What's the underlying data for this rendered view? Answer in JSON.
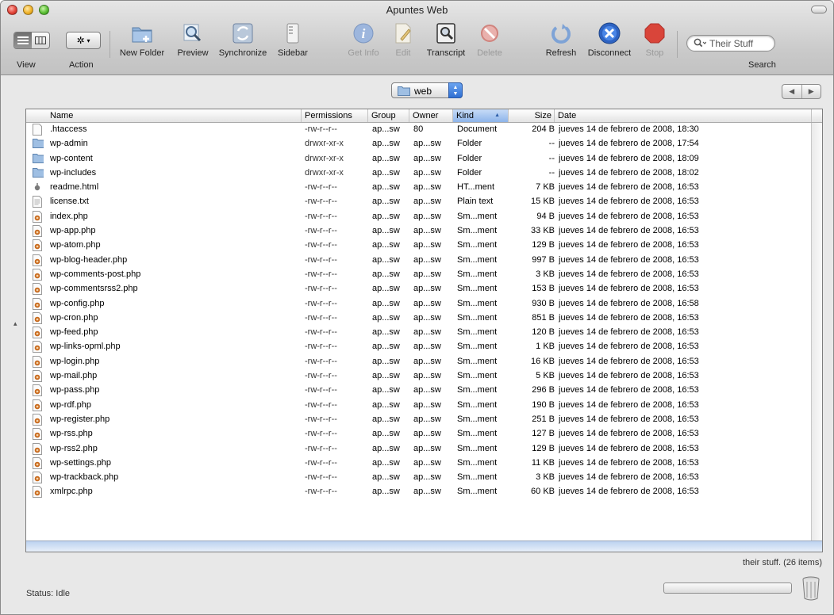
{
  "window": {
    "title": "Apuntes Web"
  },
  "toolbar": {
    "view_label": "View",
    "action_label": "Action",
    "new_folder": "New Folder",
    "preview": "Preview",
    "synchronize": "Synchronize",
    "sidebar": "Sidebar",
    "get_info": "Get Info",
    "edit": "Edit",
    "transcript": "Transcript",
    "delete": "Delete",
    "refresh": "Refresh",
    "disconnect": "Disconnect",
    "stop": "Stop",
    "search_label": "Search",
    "search_value": "Their Stuff"
  },
  "path_popup": {
    "selected": "web"
  },
  "columns": {
    "name": "Name",
    "permissions": "Permissions",
    "group": "Group",
    "owner": "Owner",
    "kind": "Kind",
    "size": "Size",
    "date": "Date"
  },
  "files": [
    {
      "icon": "document-icon",
      "name": ".htaccess",
      "perm": "-rw-r--r--",
      "group": "ap...sw",
      "owner": "80",
      "kind": "Document",
      "size": "204 B",
      "date": "jueves 14 de febrero de 2008, 18:30"
    },
    {
      "icon": "folder-icon",
      "name": "wp-admin",
      "perm": "drwxr-xr-x",
      "group": "ap...sw",
      "owner": "ap...sw",
      "kind": "Folder",
      "size": "--",
      "date": "jueves 14 de febrero de 2008, 17:54"
    },
    {
      "icon": "folder-icon",
      "name": "wp-content",
      "perm": "drwxr-xr-x",
      "group": "ap...sw",
      "owner": "ap...sw",
      "kind": "Folder",
      "size": "--",
      "date": "jueves 14 de febrero de 2008, 18:09"
    },
    {
      "icon": "folder-icon",
      "name": "wp-includes",
      "perm": "drwxr-xr-x",
      "group": "ap...sw",
      "owner": "ap...sw",
      "kind": "Folder",
      "size": "--",
      "date": "jueves 14 de febrero de 2008, 18:02"
    },
    {
      "icon": "html-icon",
      "name": "readme.html",
      "perm": "-rw-r--r--",
      "group": "ap...sw",
      "owner": "ap...sw",
      "kind": "HT...ment",
      "size": "7 KB",
      "date": "jueves 14 de febrero de 2008, 16:53"
    },
    {
      "icon": "text-file-icon",
      "name": "license.txt",
      "perm": "-rw-r--r--",
      "group": "ap...sw",
      "owner": "ap...sw",
      "kind": "Plain text",
      "size": "15 KB",
      "date": "jueves 14 de febrero de 2008, 16:53"
    },
    {
      "icon": "php-file-icon",
      "name": "index.php",
      "perm": "-rw-r--r--",
      "group": "ap...sw",
      "owner": "ap...sw",
      "kind": "Sm...ment",
      "size": "94 B",
      "date": "jueves 14 de febrero de 2008, 16:53"
    },
    {
      "icon": "php-file-icon",
      "name": "wp-app.php",
      "perm": "-rw-r--r--",
      "group": "ap...sw",
      "owner": "ap...sw",
      "kind": "Sm...ment",
      "size": "33 KB",
      "date": "jueves 14 de febrero de 2008, 16:53"
    },
    {
      "icon": "php-file-icon",
      "name": "wp-atom.php",
      "perm": "-rw-r--r--",
      "group": "ap...sw",
      "owner": "ap...sw",
      "kind": "Sm...ment",
      "size": "129 B",
      "date": "jueves 14 de febrero de 2008, 16:53"
    },
    {
      "icon": "php-file-icon",
      "name": "wp-blog-header.php",
      "perm": "-rw-r--r--",
      "group": "ap...sw",
      "owner": "ap...sw",
      "kind": "Sm...ment",
      "size": "997 B",
      "date": "jueves 14 de febrero de 2008, 16:53"
    },
    {
      "icon": "php-file-icon",
      "name": "wp-comments-post.php",
      "perm": "-rw-r--r--",
      "group": "ap...sw",
      "owner": "ap...sw",
      "kind": "Sm...ment",
      "size": "3 KB",
      "date": "jueves 14 de febrero de 2008, 16:53"
    },
    {
      "icon": "php-file-icon",
      "name": "wp-commentsrss2.php",
      "perm": "-rw-r--r--",
      "group": "ap...sw",
      "owner": "ap...sw",
      "kind": "Sm...ment",
      "size": "153 B",
      "date": "jueves 14 de febrero de 2008, 16:53"
    },
    {
      "icon": "php-file-icon",
      "name": "wp-config.php",
      "perm": "-rw-r--r--",
      "group": "ap...sw",
      "owner": "ap...sw",
      "kind": "Sm...ment",
      "size": "930 B",
      "date": "jueves 14 de febrero de 2008, 16:58"
    },
    {
      "icon": "php-file-icon",
      "name": "wp-cron.php",
      "perm": "-rw-r--r--",
      "group": "ap...sw",
      "owner": "ap...sw",
      "kind": "Sm...ment",
      "size": "851 B",
      "date": "jueves 14 de febrero de 2008, 16:53"
    },
    {
      "icon": "php-file-icon",
      "name": "wp-feed.php",
      "perm": "-rw-r--r--",
      "group": "ap...sw",
      "owner": "ap...sw",
      "kind": "Sm...ment",
      "size": "120 B",
      "date": "jueves 14 de febrero de 2008, 16:53"
    },
    {
      "icon": "php-file-icon",
      "name": "wp-links-opml.php",
      "perm": "-rw-r--r--",
      "group": "ap...sw",
      "owner": "ap...sw",
      "kind": "Sm...ment",
      "size": "1 KB",
      "date": "jueves 14 de febrero de 2008, 16:53"
    },
    {
      "icon": "php-file-icon",
      "name": "wp-login.php",
      "perm": "-rw-r--r--",
      "group": "ap...sw",
      "owner": "ap...sw",
      "kind": "Sm...ment",
      "size": "16 KB",
      "date": "jueves 14 de febrero de 2008, 16:53"
    },
    {
      "icon": "php-file-icon",
      "name": "wp-mail.php",
      "perm": "-rw-r--r--",
      "group": "ap...sw",
      "owner": "ap...sw",
      "kind": "Sm...ment",
      "size": "5 KB",
      "date": "jueves 14 de febrero de 2008, 16:53"
    },
    {
      "icon": "php-file-icon",
      "name": "wp-pass.php",
      "perm": "-rw-r--r--",
      "group": "ap...sw",
      "owner": "ap...sw",
      "kind": "Sm...ment",
      "size": "296 B",
      "date": "jueves 14 de febrero de 2008, 16:53"
    },
    {
      "icon": "php-file-icon",
      "name": "wp-rdf.php",
      "perm": "-rw-r--r--",
      "group": "ap...sw",
      "owner": "ap...sw",
      "kind": "Sm...ment",
      "size": "190 B",
      "date": "jueves 14 de febrero de 2008, 16:53"
    },
    {
      "icon": "php-file-icon",
      "name": "wp-register.php",
      "perm": "-rw-r--r--",
      "group": "ap...sw",
      "owner": "ap...sw",
      "kind": "Sm...ment",
      "size": "251 B",
      "date": "jueves 14 de febrero de 2008, 16:53"
    },
    {
      "icon": "php-file-icon",
      "name": "wp-rss.php",
      "perm": "-rw-r--r--",
      "group": "ap...sw",
      "owner": "ap...sw",
      "kind": "Sm...ment",
      "size": "127 B",
      "date": "jueves 14 de febrero de 2008, 16:53"
    },
    {
      "icon": "php-file-icon",
      "name": "wp-rss2.php",
      "perm": "-rw-r--r--",
      "group": "ap...sw",
      "owner": "ap...sw",
      "kind": "Sm...ment",
      "size": "129 B",
      "date": "jueves 14 de febrero de 2008, 16:53"
    },
    {
      "icon": "php-file-icon",
      "name": "wp-settings.php",
      "perm": "-rw-r--r--",
      "group": "ap...sw",
      "owner": "ap...sw",
      "kind": "Sm...ment",
      "size": "11 KB",
      "date": "jueves 14 de febrero de 2008, 16:53"
    },
    {
      "icon": "php-file-icon",
      "name": "wp-trackback.php",
      "perm": "-rw-r--r--",
      "group": "ap...sw",
      "owner": "ap...sw",
      "kind": "Sm...ment",
      "size": "3 KB",
      "date": "jueves 14 de febrero de 2008, 16:53"
    },
    {
      "icon": "php-file-icon",
      "name": "xmlrpc.php",
      "perm": "-rw-r--r--",
      "group": "ap...sw",
      "owner": "ap...sw",
      "kind": "Sm...ment",
      "size": "60 KB",
      "date": "jueves 14 de febrero de 2008, 16:53"
    }
  ],
  "footer": {
    "item_count": "their stuff. (26 items)",
    "status": "Status: Idle"
  },
  "colors": {
    "accent_blue": "#2f6fd2",
    "sort_header": "#8db4ea",
    "stop_red": "#d9453a",
    "php_orange": "#c96a1e"
  }
}
